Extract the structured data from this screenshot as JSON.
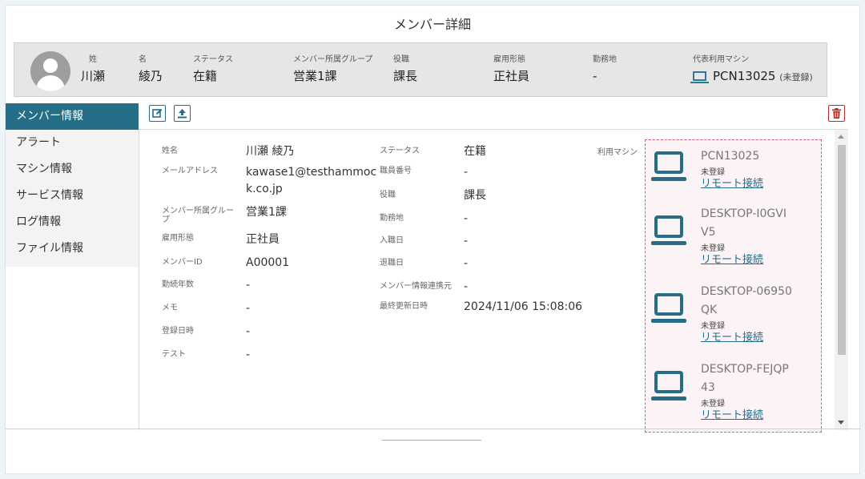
{
  "page": {
    "title": "メンバー詳細"
  },
  "summary": {
    "last_name": {
      "label": "姓",
      "value": "川瀬"
    },
    "first_name": {
      "label": "名",
      "value": "綾乃"
    },
    "status": {
      "label": "ステータス",
      "value": "在籍"
    },
    "group": {
      "label": "メンバー所属グループ",
      "value": "営業1課"
    },
    "position": {
      "label": "役職",
      "value": "課長"
    },
    "employment": {
      "label": "雇用形態",
      "value": "正社員"
    },
    "location": {
      "label": "勤務地",
      "value": "-"
    },
    "machine": {
      "label": "代表利用マシン",
      "value": "PCN13025",
      "note": "(未登録)"
    }
  },
  "sidebar": {
    "items": [
      {
        "label": "メンバー情報",
        "active": true
      },
      {
        "label": "アラート"
      },
      {
        "label": "マシン情報"
      },
      {
        "label": "サービス情報"
      },
      {
        "label": "ログ情報"
      },
      {
        "label": "ファイル情報"
      }
    ]
  },
  "toolbar": {
    "edit_icon": "edit-icon",
    "upload_icon": "upload-icon",
    "delete_icon": "trash-icon"
  },
  "details": {
    "col1": [
      {
        "label": "姓名",
        "value": "川瀬 綾乃"
      },
      {
        "label": "メールアドレス",
        "value": "kawase1@testhammoc",
        "value2": "k.co.jp"
      },
      {
        "label": "メンバー所属グルー",
        "label2": "プ",
        "value": "営業1課"
      },
      {
        "label": "雇用形態",
        "value": "正社員"
      },
      {
        "label": "メンバーID",
        "value": "A00001"
      },
      {
        "label": "勤続年数",
        "value": "-"
      },
      {
        "label": "メモ",
        "value": "-"
      },
      {
        "label": "登録日時",
        "value": "-"
      },
      {
        "label": "テスト",
        "value": "-"
      }
    ],
    "col2": [
      {
        "label": "ステータス",
        "value": "在籍"
      },
      {
        "label": "職員番号",
        "value": "-"
      },
      {
        "label": "役職",
        "value": "課長"
      },
      {
        "label": "勤務地",
        "value": "-"
      },
      {
        "label": "入職日",
        "value": "-"
      },
      {
        "label": "退職日",
        "value": "-"
      },
      {
        "label": "メンバー情報連携元",
        "value": "-"
      },
      {
        "label": "最終更新日時",
        "value": "2024/11/06 15:08:06"
      }
    ],
    "machines_label": "利用マシン",
    "machines": [
      {
        "name": "PCN13025",
        "name2": "",
        "status": "未登録",
        "link": "リモート接続"
      },
      {
        "name": "DESKTOP-I0GVI",
        "name2": "V5",
        "status": "未登録",
        "link": "リモート接続"
      },
      {
        "name": "DESKTOP-06950",
        "name2": "QK",
        "status": "未登録",
        "link": "リモート接続"
      },
      {
        "name": "DESKTOP-FEJQP",
        "name2": "43",
        "status": "未登録",
        "link": "リモート接続"
      }
    ]
  },
  "colors": {
    "accent": "#246e88",
    "danger": "#c62828",
    "machine_border": "#e05a7a"
  }
}
